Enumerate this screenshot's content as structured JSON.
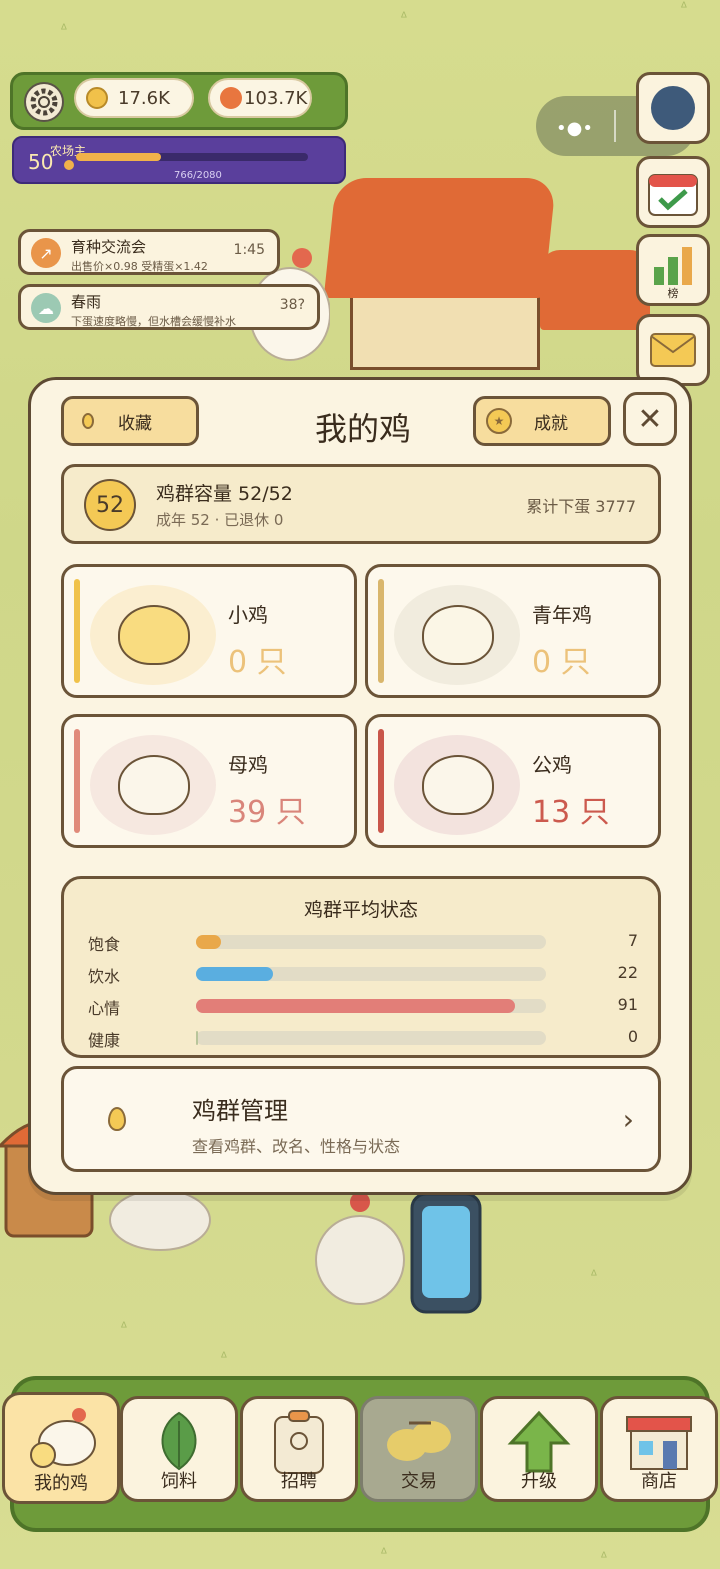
{
  "hud": {
    "coins": "17.6K",
    "gems": "103.7K",
    "level": "50",
    "level_title": "农场主",
    "xp_text": "766/2080",
    "xp_progress": 0.368
  },
  "events": [
    {
      "title": "育种交流会",
      "subtitle": "出售价×0.98 受精蛋×1.42",
      "right": "1:45",
      "icon": "trend-up-icon"
    },
    {
      "title": "春雨",
      "subtitle": "下蛋速度略慢，但水槽会缓慢补水",
      "right": "38?",
      "icon": "rain-cloud-icon"
    }
  ],
  "side_buttons": [
    {
      "name": "avatar-button"
    },
    {
      "name": "calendar-checkin-button"
    },
    {
      "name": "leaderboard-button",
      "label": "榜"
    },
    {
      "name": "mail-button"
    }
  ],
  "modal": {
    "title": "我的鸡",
    "collect_label": "收藏",
    "achievement_label": "成就",
    "close_symbol": "✕",
    "capacity": {
      "badge": "52",
      "title": "鸡群容量 52/52",
      "subtitle": "成年 52 · 已退休 0",
      "eggs_total": "累计下蛋 3777"
    },
    "groups": [
      {
        "name": "小鸡",
        "count": "0 只",
        "stripe": "#f0c24a",
        "circle": "#fbeed0",
        "count_color": "#ecc27a",
        "body": "#f9dc80"
      },
      {
        "name": "青年鸡",
        "count": "0 只",
        "stripe": "#d9b66c",
        "circle": "#f1ecde",
        "count_color": "#ecc27a",
        "body": "#fbf6e6"
      },
      {
        "name": "母鸡",
        "count": "39 只",
        "stripe": "#e08a7a",
        "circle": "#f6e8e0",
        "count_color": "#d9857a",
        "body": "#fbf6ea"
      },
      {
        "name": "公鸡",
        "count": "13 只",
        "stripe": "#c9564a",
        "circle": "#f3e3de",
        "count_color": "#cc5a4e",
        "body": "#fbf6ea"
      }
    ],
    "status": {
      "title": "鸡群平均状态",
      "rows": [
        {
          "label": "饱食",
          "value": "7",
          "fraction": 0.07,
          "color": "#e9a84a"
        },
        {
          "label": "饮水",
          "value": "22",
          "fraction": 0.22,
          "color": "#5aaee0"
        },
        {
          "label": "心情",
          "value": "91",
          "fraction": 0.91,
          "color": "#e27e78"
        },
        {
          "label": "健康",
          "value": "0",
          "fraction": 0.0,
          "color": "#b9c59a"
        }
      ]
    },
    "manage": {
      "title": "鸡群管理",
      "subtitle": "查看鸡群、改名、性格与状态",
      "arrow": "›"
    }
  },
  "nav": [
    {
      "label": "我的鸡",
      "icon": "chicken-icon",
      "active": true
    },
    {
      "label": "饲料",
      "icon": "leaf-icon"
    },
    {
      "label": "招聘",
      "icon": "badge-icon"
    },
    {
      "label": "交易",
      "icon": "trade-eggs-icon",
      "dim": true
    },
    {
      "label": "升级",
      "icon": "up-arrow-icon"
    },
    {
      "label": "商店",
      "icon": "shop-icon"
    }
  ],
  "colors": {
    "panel": "#fbf4e1",
    "border": "#5e4a33",
    "grass": "#d6dc8e",
    "hud_green": "#6e9b3a",
    "level_purple": "#5a3f9c"
  }
}
